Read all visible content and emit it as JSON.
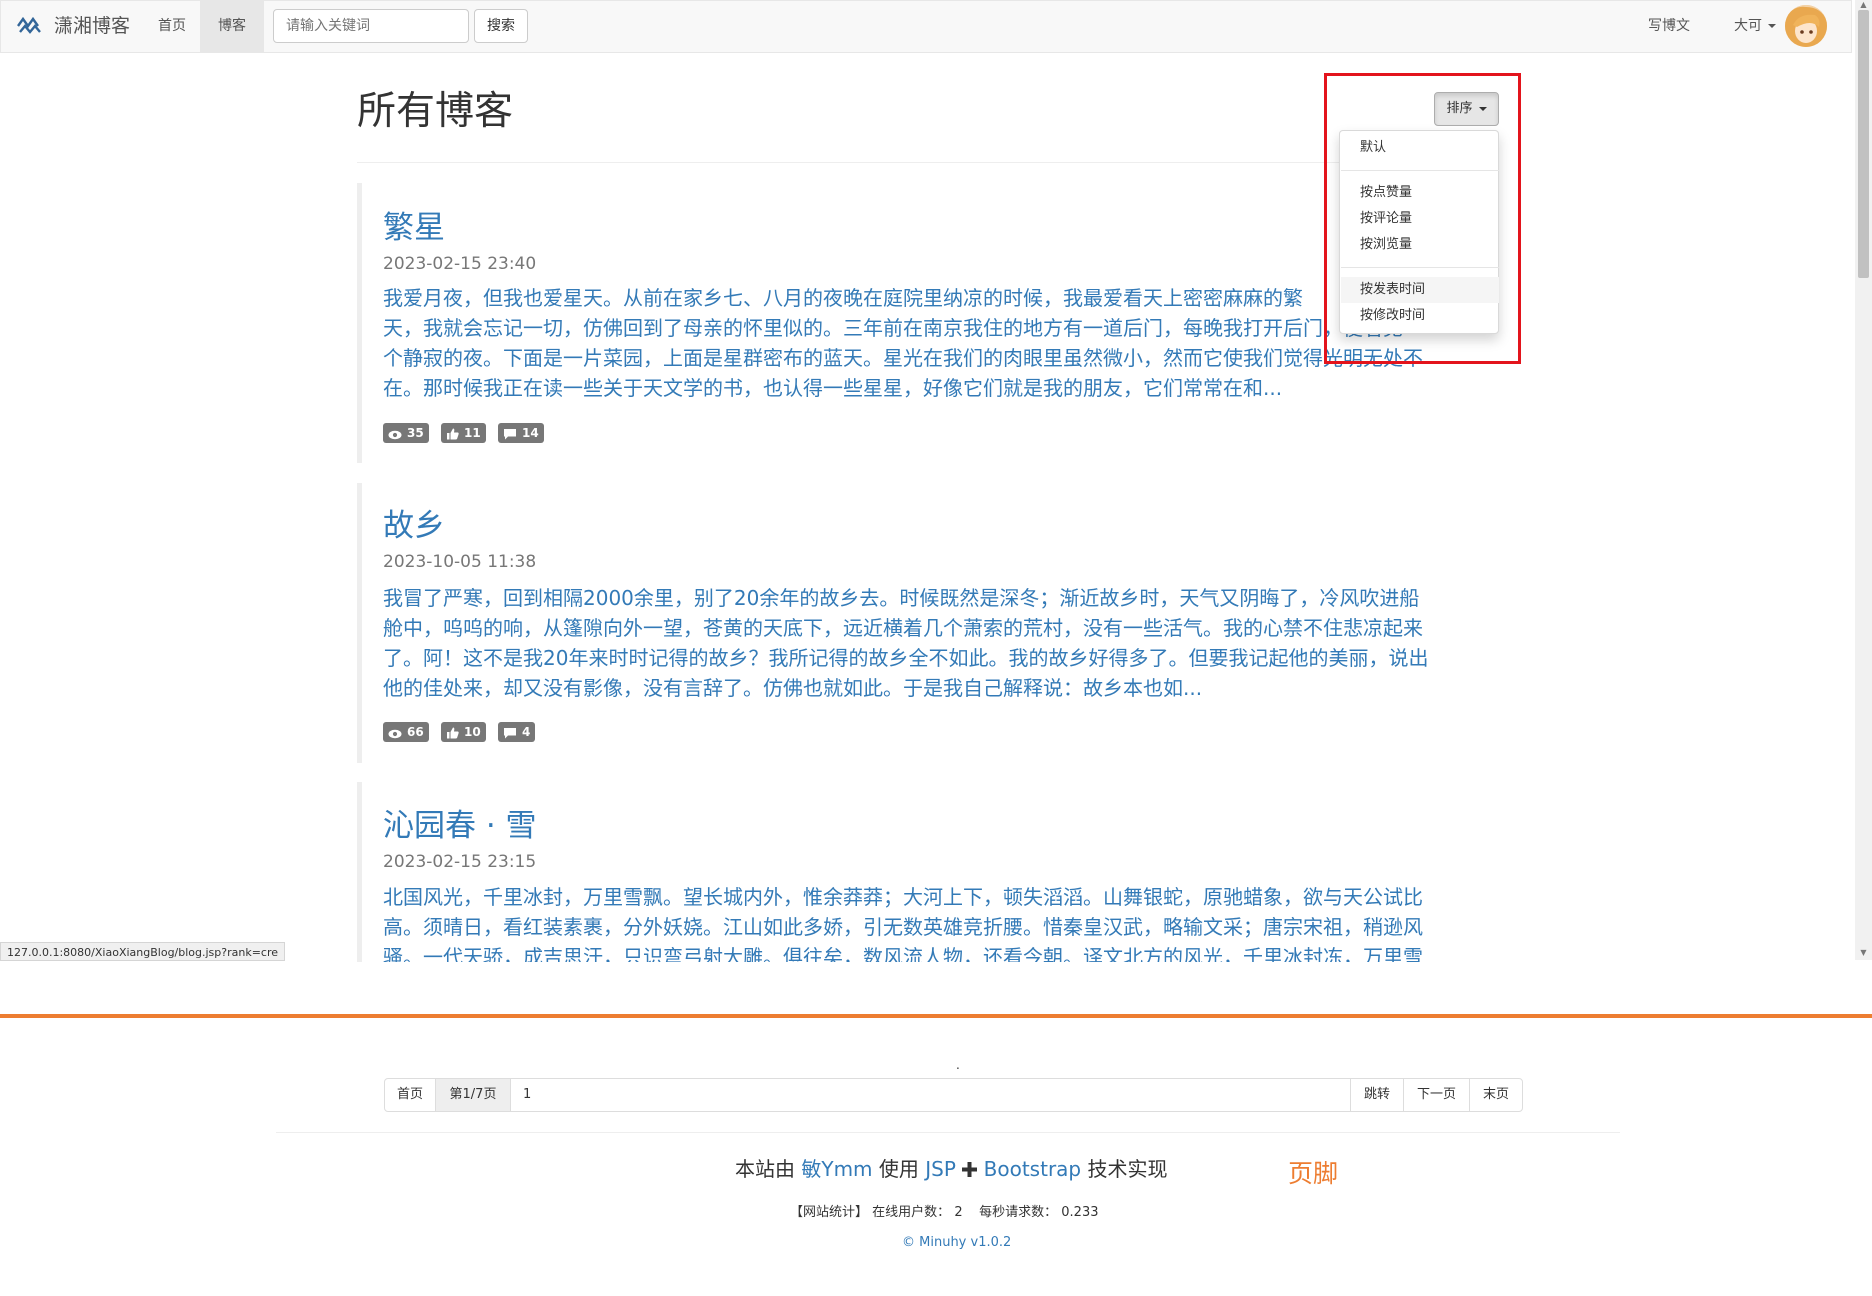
{
  "navbar": {
    "brand": "潇湘博客",
    "home": "首页",
    "blog": "博客",
    "search_placeholder": "请输入关键词",
    "search_button": "搜索",
    "write": "写博文",
    "user": "大可"
  },
  "header": {
    "title": "所有博客",
    "sort_button": "排序"
  },
  "sort_menu": {
    "items": [
      "默认",
      "按点赞量",
      "按评论量",
      "按浏览量",
      "按发表时间",
      "按修改时间"
    ],
    "highlighted": "按发表时间"
  },
  "posts": [
    {
      "title": "繁星",
      "date": "2023-02-15 23:40",
      "excerpt_lines": [
        "我爱月夜，但我也爱星天。从前在家乡七、八月的夜晚在庭院里纳凉的时候，我最爱看天上密密麻麻的繁",
        "天，我就会忘记一切，仿佛回到了母亲的怀里似的。三年前在南京我住的地方有一道后门，每晚我打开后门，便看见",
        "个静寂的夜。下面是一片菜园，上面是星群密布的蓝天。星光在我们的肉眼里虽然微小，然而它使我们觉得光明无处不",
        "在。那时候我正在读一些关于天文学的书，也认得一些星星，好像它们就是我的朋友，它们常常在和..."
      ],
      "views": "35",
      "likes": "11",
      "comments": "14"
    },
    {
      "title": "故乡",
      "date": "2023-10-05 11:38",
      "excerpt_lines": [
        "我冒了严寒，回到相隔2000余里，别了20余年的故乡去。时候既然是深冬；渐近故乡时，天气又阴晦了，冷风吹进船",
        "舱中，呜呜的响，从篷隙向外一望，苍黄的天底下，远近横着几个萧索的荒村，没有一些活气。我的心禁不住悲凉起来",
        "了。阿！这不是我20年来时时记得的故乡？我所记得的故乡全不如此。我的故乡好得多了。但要我记起他的美丽，说出",
        "他的佳处来，却又没有影像，没有言辞了。仿佛也就如此。于是我自己解释说：故乡本也如..."
      ],
      "views": "66",
      "likes": "10",
      "comments": "4"
    },
    {
      "title": "沁园春 · 雪",
      "date": "2023-02-15 23:15",
      "excerpt_lines": [
        "北国风光，千里冰封，万里雪飘。望长城内外，惟余莽莽；大河上下，顿失滔滔。山舞银蛇，原驰蜡象，欲与天公试比",
        "高。须晴日，看红装素裹，分外妖娆。江山如此多娇，引无数英雄竞折腰。惜秦皇汉武，略输文采；唐宗宋祖，稍逊风",
        "骚。一代天骄，成吉思汗，只识弯弓射大雕。俱往矣，数风流人物，还看今朝。译文北方的风光，千里冰封冻，万里雪"
      ]
    }
  ],
  "status_url": "127.0.0.1:8080/XiaoXiangBlog/blog.jsp?rank=cre",
  "pagination": {
    "first": "首页",
    "page_info": "第1/7页",
    "page_input": "1",
    "jump": "跳转",
    "next": "下一页",
    "last": "末页"
  },
  "dot": ".",
  "footer": {
    "prefix": "本站由",
    "author": "敏Ymm",
    "use": "使用",
    "tech1": "JSP",
    "tech2": "Bootstrap",
    "suffix": "技术实现",
    "label": "页脚",
    "stats_title": "【网站统计】",
    "online_label": "在线用户数：",
    "online_value": "2",
    "rps_label": "每秒请求数：",
    "rps_value": "0.233",
    "copyright": "© Minuhy v1.0.2"
  },
  "colors": {
    "link": "#337ab7",
    "accent_orange": "#ed7d31",
    "highlight_box": "#e3141c",
    "badge": "#777777"
  }
}
